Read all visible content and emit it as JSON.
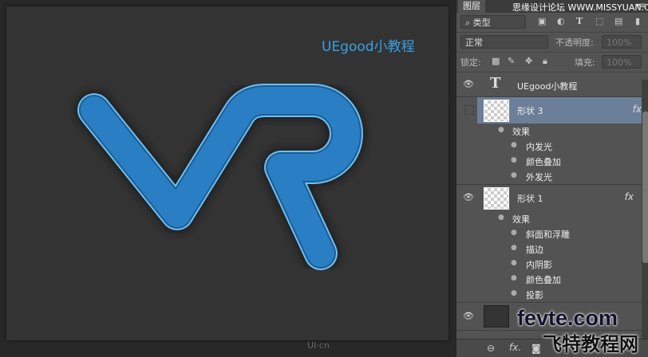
{
  "canvas": {
    "text_layer_content": "UEgood小教程",
    "watermark": "UI·cn"
  },
  "panel": {
    "tab": "图层",
    "watermark_top": "思缘设计论坛 WWW.MISSYUAN.COM",
    "filter_kind": "类型",
    "blend_mode": "正常",
    "opacity_label": "不透明度:",
    "opacity": "100%",
    "lock_label": "锁定:",
    "fill_label": "填充:",
    "fill": "100%",
    "layers": [
      {
        "name": "UEgood小教程",
        "type": "text",
        "thumb": "T"
      },
      {
        "name": "形状 3",
        "fx": "fx",
        "effects_label": "效果",
        "effects": [
          "内发光",
          "颜色叠加",
          "外发光"
        ]
      },
      {
        "name": "形状 1",
        "fx": "fx",
        "effects_label": "效果",
        "effects": [
          "斜面和浮雕",
          "描边",
          "内阴影",
          "颜色叠加",
          "投影"
        ]
      },
      {
        "name": "背景"
      }
    ],
    "footer": {
      "link": "⊖",
      "fx": "fx."
    }
  },
  "watermark_bottom": {
    "line1": "fevte.com",
    "line2": "飞特教程网"
  },
  "colors": {
    "accent": "#3aa0e4",
    "shape": "#2a7fc4",
    "selected_layer": "#6c7f98"
  }
}
